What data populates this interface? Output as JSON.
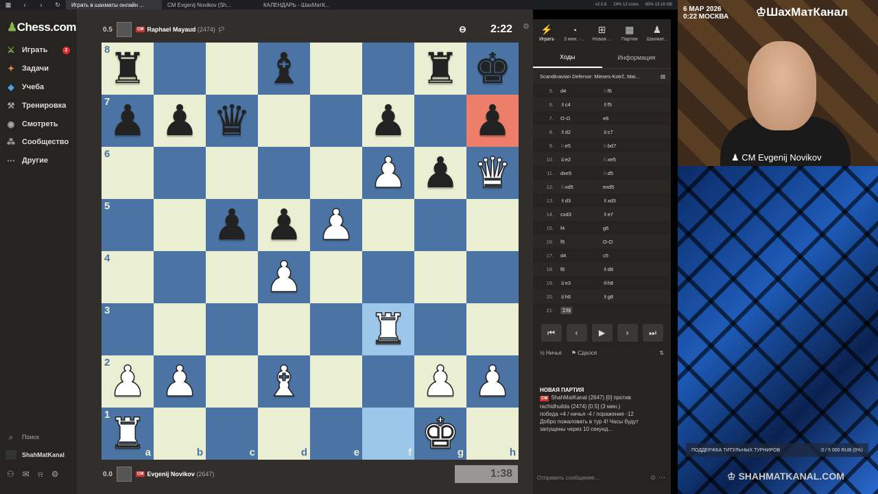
{
  "browser": {
    "tabs": [
      "Играть в шахматы онлайн ...",
      "CM Evgenij Novikov (Sh...",
      "КАЛЕНДАРЬ - ШахМатК..."
    ],
    "stats": [
      "v2.0.8",
      "24% 12 cores",
      "85% 13.16 GB"
    ]
  },
  "nav": {
    "logo": "Chess",
    "logo_suffix": ".com",
    "items": [
      {
        "label": "Играть",
        "icon": "play-icon",
        "badge": "2"
      },
      {
        "label": "Задачи",
        "icon": "puzzle-icon"
      },
      {
        "label": "Учеба",
        "icon": "learn-icon"
      },
      {
        "label": "Тренировка",
        "icon": "train-icon"
      },
      {
        "label": "Смотреть",
        "icon": "watch-icon"
      },
      {
        "label": "Сообщество",
        "icon": "community-icon"
      },
      {
        "label": "Другие",
        "icon": "more-icon"
      }
    ],
    "search": "Поиск",
    "user": "ShahMatKanal"
  },
  "game": {
    "top_player": {
      "score": "0.5",
      "title": "CM",
      "name": "Raphael Mayaud",
      "rating": "(2474)",
      "clock": "2:22"
    },
    "bottom_player": {
      "score": "0.0",
      "title": "CM",
      "name": "Evgenij Novikov",
      "rating": "(2647)",
      "clock": "1:38"
    },
    "ranks": [
      "8",
      "7",
      "6",
      "5",
      "4",
      "3",
      "2",
      "1"
    ],
    "files": [
      "a",
      "b",
      "c",
      "d",
      "e",
      "f",
      "g",
      "h"
    ],
    "board": [
      [
        "bR",
        "",
        "",
        "bB",
        "",
        "",
        "bR",
        "bK"
      ],
      [
        "bP",
        "bP",
        "bQ",
        "",
        "",
        "bP",
        "",
        "bP"
      ],
      [
        "",
        "",
        "",
        "",
        "",
        "wP",
        "bP",
        "wQ"
      ],
      [
        "",
        "",
        "bP",
        "bP",
        "wP",
        "",
        "",
        ""
      ],
      [
        "",
        "",
        "",
        "wP",
        "",
        "",
        "",
        ""
      ],
      [
        "",
        "",
        "",
        "",
        "",
        "wR",
        "",
        ""
      ],
      [
        "wP",
        "wP",
        "",
        "wB",
        "",
        "",
        "wP",
        "wP"
      ],
      [
        "wR",
        "",
        "",
        "",
        "",
        "",
        "wK",
        ""
      ]
    ]
  },
  "panel": {
    "tabs": [
      {
        "label": "Играть",
        "icon": "lightning-icon"
      },
      {
        "label": "3 мин. -...",
        "icon": "timer-icon"
      },
      {
        "label": "Новая ...",
        "icon": "plus-icon"
      },
      {
        "label": "Партии",
        "icon": "board-icon"
      },
      {
        "label": "Шахмат...",
        "icon": "players-icon"
      }
    ],
    "subtabs": [
      "Ходы",
      "Информация"
    ],
    "opening": "Scandinavian Defense: Mieses-Kotrč, Mai...",
    "moves": [
      {
        "n": "5.",
        "w": "d4",
        "b": "♘f6"
      },
      {
        "n": "6.",
        "w": "♗c4",
        "b": "♗f5"
      },
      {
        "n": "7.",
        "w": "O-O",
        "b": "e6"
      },
      {
        "n": "8.",
        "w": "♗d2",
        "b": "♕c7"
      },
      {
        "n": "9.",
        "w": "♘e5",
        "b": "♘bd7"
      },
      {
        "n": "10.",
        "w": "♕e2",
        "b": "♘xe5"
      },
      {
        "n": "11.",
        "w": "dxe5",
        "b": "♘d5"
      },
      {
        "n": "12.",
        "w": "♘xd5",
        "b": "exd5"
      },
      {
        "n": "13.",
        "w": "♗d3",
        "b": "♗xd3"
      },
      {
        "n": "14.",
        "w": "cxd3",
        "b": "♗e7"
      },
      {
        "n": "15.",
        "w": "f4",
        "b": "g6"
      },
      {
        "n": "16.",
        "w": "f5",
        "b": "O-O"
      },
      {
        "n": "17.",
        "w": "d4",
        "b": "c5"
      },
      {
        "n": "18.",
        "w": "f6",
        "b": "♗d8"
      },
      {
        "n": "19.",
        "w": "♕e3",
        "b": "♔h8"
      },
      {
        "n": "20.",
        "w": "♕h6",
        "b": "♗g8"
      },
      {
        "n": "21.",
        "w": "♖f3",
        "b": ""
      }
    ],
    "draw": "Ничья",
    "resign": "Сдался",
    "chat_title": "НОВАЯ ПАРТИЯ",
    "chat_line1": "ShahMatKanal (2647) [0] против",
    "chat_line2": "rachidhuilda (2474) [0.5] (3 мин.)",
    "chat_line3": "победа +4 / ничья -4 / поражение -12",
    "chat_line4": "Добро пожаловать в тур 4! Часы будут запущены через 10 секунд...",
    "message_placeholder": "Отправить сообщение..."
  },
  "stream": {
    "date": "6 МАР 2026",
    "time": "0:22 МОСКВА",
    "brand": "ШахМатКанал",
    "cam_name": "CM Evgenij Novikov",
    "support_label": "ПОДДЕРЖКА ТИТУЛЬНЫХ ТУРНИРОВ",
    "support_value": "0 / 5 000 RUB (0%)",
    "site": "SHAHMATKANAL.COM"
  }
}
